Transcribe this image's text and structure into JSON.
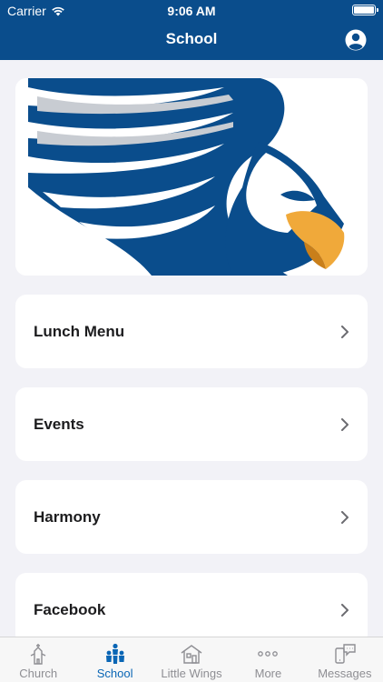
{
  "status_bar": {
    "carrier": "Carrier",
    "time": "9:06 AM"
  },
  "header": {
    "title": "School"
  },
  "banner": {
    "image": "eagle-mascot-logo"
  },
  "menu": [
    {
      "label": "Lunch Menu"
    },
    {
      "label": "Events"
    },
    {
      "label": "Harmony"
    },
    {
      "label": "Facebook"
    }
  ],
  "tabs": [
    {
      "label": "Church",
      "icon": "church-icon"
    },
    {
      "label": "School",
      "icon": "people-icon",
      "active": true
    },
    {
      "label": "Little Wings",
      "icon": "house-icon"
    },
    {
      "label": "More",
      "icon": "ellipsis-icon"
    },
    {
      "label": "Messages",
      "icon": "messages-icon"
    }
  ],
  "colors": {
    "brand": "#0a4d8c",
    "active_tab": "#0a66b5",
    "beak": "#f0a93a"
  }
}
